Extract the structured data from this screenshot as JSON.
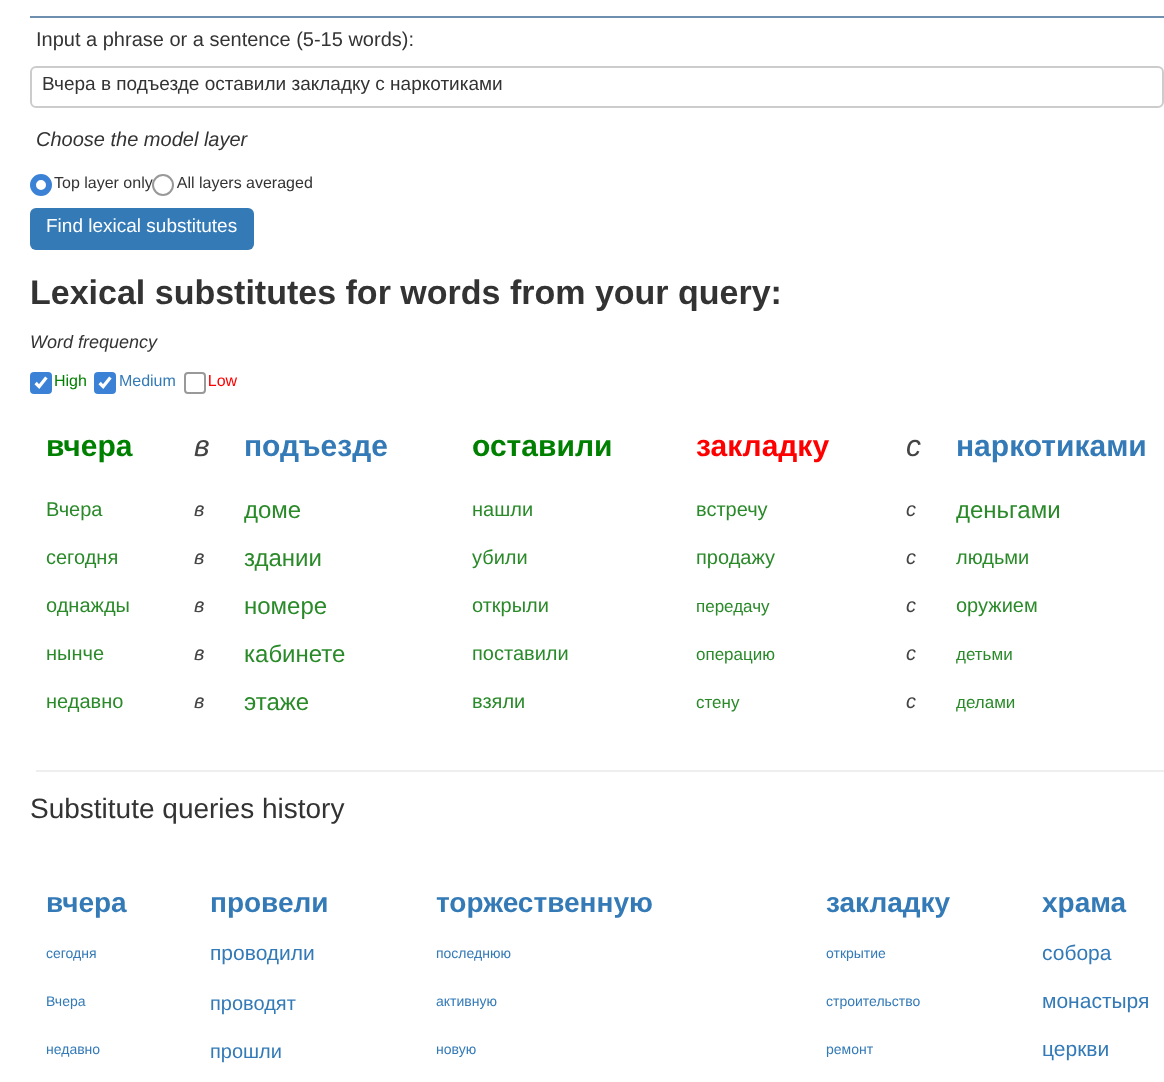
{
  "query_form": {
    "label": "Input a phrase or a sentence (5-15 words):",
    "value": "Вчера в подъезде оставили закладку с наркотиками",
    "layer_label": "Choose the model layer",
    "layers": [
      {
        "label": "Top layer only",
        "selected": true
      },
      {
        "label": "All layers averaged",
        "selected": false
      }
    ],
    "submit": "Find lexical substitutes"
  },
  "results": {
    "title": "Lexical substitutes for words from your query:",
    "frequency_label": "Word frequency",
    "filters": [
      {
        "label": "High",
        "kind": "high",
        "checked": true
      },
      {
        "label": "Medium",
        "kind": "medium",
        "checked": true
      },
      {
        "label": "Low",
        "kind": "low",
        "checked": false
      }
    ],
    "columns": [
      {
        "word": "вчера",
        "kind": "high",
        "substitutes": [
          {
            "text": "Вчера",
            "kind": "normal"
          },
          {
            "text": "сегодня",
            "kind": "normal"
          },
          {
            "text": "однажды",
            "kind": "normal"
          },
          {
            "text": "нынче",
            "kind": "normal"
          },
          {
            "text": "недавно",
            "kind": "normal"
          }
        ]
      },
      {
        "word": "в",
        "kind": "function",
        "substitutes": [
          {
            "text": "в",
            "kind": "function"
          },
          {
            "text": "в",
            "kind": "function"
          },
          {
            "text": "в",
            "kind": "function"
          },
          {
            "text": "в",
            "kind": "function"
          },
          {
            "text": "в",
            "kind": "function"
          }
        ]
      },
      {
        "word": "подъезде",
        "kind": "medium",
        "substitutes": [
          {
            "text": "доме",
            "kind": "big"
          },
          {
            "text": "здании",
            "kind": "big"
          },
          {
            "text": "номере",
            "kind": "big"
          },
          {
            "text": "кабинете",
            "kind": "big"
          },
          {
            "text": "этаже",
            "kind": "big"
          }
        ]
      },
      {
        "word": "оставили",
        "kind": "high",
        "substitutes": [
          {
            "text": "нашли",
            "kind": "normal"
          },
          {
            "text": "убили",
            "kind": "normal"
          },
          {
            "text": "открыли",
            "kind": "normal"
          },
          {
            "text": "поставили",
            "kind": "normal"
          },
          {
            "text": "взяли",
            "kind": "normal"
          }
        ]
      },
      {
        "word": "закладку",
        "kind": "low",
        "substitutes": [
          {
            "text": "встречу",
            "kind": "normal"
          },
          {
            "text": "продажу",
            "kind": "normal"
          },
          {
            "text": "передачу",
            "kind": "small"
          },
          {
            "text": "операцию",
            "kind": "small"
          },
          {
            "text": "стену",
            "kind": "small"
          }
        ]
      },
      {
        "word": "с",
        "kind": "function",
        "substitutes": [
          {
            "text": "с",
            "kind": "function"
          },
          {
            "text": "с",
            "kind": "function"
          },
          {
            "text": "с",
            "kind": "function"
          },
          {
            "text": "с",
            "kind": "function"
          },
          {
            "text": "с",
            "kind": "function"
          }
        ]
      },
      {
        "word": "наркотиками",
        "kind": "medium",
        "substitutes": [
          {
            "text": "деньгами",
            "kind": "big"
          },
          {
            "text": "людьми",
            "kind": "normal"
          },
          {
            "text": "оружием",
            "kind": "normal"
          },
          {
            "text": "детьми",
            "kind": "small"
          },
          {
            "text": "делами",
            "kind": "small"
          }
        ]
      }
    ]
  },
  "history": {
    "title": "Substitute queries history",
    "columns": [
      {
        "word": "вчера",
        "substitutes": [
          {
            "text": "сегодня",
            "kind": "tiny"
          },
          {
            "text": "Вчера",
            "kind": "tiny"
          },
          {
            "text": "недавно",
            "kind": "tiny"
          }
        ]
      },
      {
        "word": "провели",
        "substitutes": [
          {
            "text": "проводили",
            "kind": "big"
          },
          {
            "text": "проводят",
            "kind": "normal"
          },
          {
            "text": "прошли",
            "kind": "normal"
          }
        ]
      },
      {
        "word": "торжественную",
        "substitutes": [
          {
            "text": "последнюю",
            "kind": "tiny"
          },
          {
            "text": "активную",
            "kind": "tiny"
          },
          {
            "text": "новую",
            "kind": "tiny"
          }
        ]
      },
      {
        "word": "закладку",
        "substitutes": [
          {
            "text": "открытие",
            "kind": "tiny"
          },
          {
            "text": "строительство",
            "kind": "tiny"
          },
          {
            "text": "ремонт",
            "kind": "tiny"
          }
        ]
      },
      {
        "word": "храма",
        "substitutes": [
          {
            "text": "собора",
            "kind": "big"
          },
          {
            "text": "монастыря",
            "kind": "big"
          },
          {
            "text": "церкви",
            "kind": "big"
          }
        ]
      }
    ]
  }
}
